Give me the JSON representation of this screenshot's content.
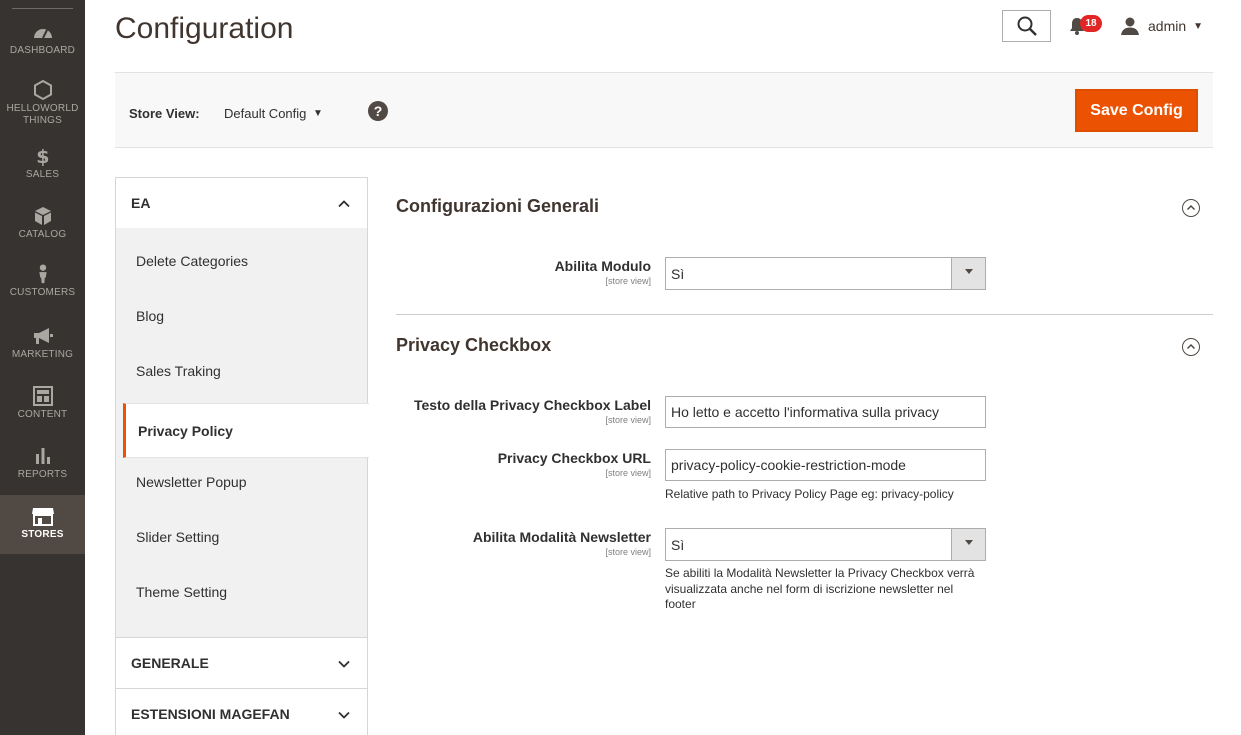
{
  "nav": {
    "items": [
      {
        "label": "DASHBOARD",
        "icon": "dashboard-icon"
      },
      {
        "label": "HELLOWORLD THINGS",
        "icon": "hexagon-icon"
      },
      {
        "label": "SALES",
        "icon": "dollar-icon"
      },
      {
        "label": "CATALOG",
        "icon": "box-icon"
      },
      {
        "label": "CUSTOMERS",
        "icon": "person-icon"
      },
      {
        "label": "MARKETING",
        "icon": "megaphone-icon"
      },
      {
        "label": "CONTENT",
        "icon": "layout-icon"
      },
      {
        "label": "REPORTS",
        "icon": "bar-chart-icon"
      },
      {
        "label": "STORES",
        "icon": "store-icon"
      }
    ],
    "active": "STORES"
  },
  "header": {
    "title": "Configuration",
    "notifications_count": "18",
    "user_name": "admin"
  },
  "storebar": {
    "label": "Store View:",
    "value": "Default Config",
    "help": "?",
    "save_label": "Save Config"
  },
  "tabs": {
    "groups": [
      {
        "label": "EA",
        "expanded": true
      },
      {
        "label": "GENERALE",
        "expanded": false
      },
      {
        "label": "ESTENSIONI MAGEFAN",
        "expanded": false
      }
    ],
    "items": [
      {
        "label": "Delete Categories"
      },
      {
        "label": "Blog"
      },
      {
        "label": "Sales Traking"
      },
      {
        "label": "Privacy Policy"
      },
      {
        "label": "Newsletter Popup"
      },
      {
        "label": "Slider Setting"
      },
      {
        "label": "Theme Setting"
      }
    ],
    "active_item": "Privacy Policy"
  },
  "main": {
    "sections": [
      {
        "title": "Configurazioni Generali",
        "fields": [
          {
            "label": "Abilita Modulo",
            "scope": "[store view]",
            "value": "Sì"
          }
        ]
      },
      {
        "title": "Privacy Checkbox",
        "fields": [
          {
            "label": "Testo della Privacy Checkbox Label",
            "scope": "[store view]",
            "value": "Ho letto e accetto l'informativa sulla privacy"
          },
          {
            "label": "Privacy Checkbox URL",
            "scope": "[store view]",
            "value": "privacy-policy-cookie-restriction-mode",
            "note": "Relative path to Privacy Policy Page eg: privacy-policy"
          },
          {
            "label": "Abilita Modalità Newsletter",
            "scope": "[store view]",
            "value": "Sì",
            "note": "Se abiliti la Modalità Newsletter la Privacy Checkbox verrà visualizzata anche nel form di iscrizione newsletter nel footer"
          }
        ]
      }
    ]
  },
  "colors": {
    "nav_bg": "#373330",
    "nav_active_bg": "#514943",
    "accent": "#eb5202",
    "badge": "#e22626"
  }
}
